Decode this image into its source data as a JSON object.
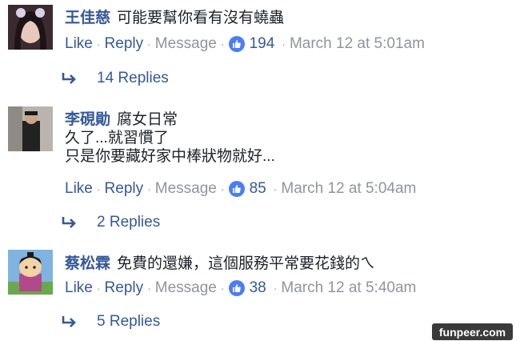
{
  "comments": [
    {
      "author": "王佳慈",
      "lines": [
        "可能要幫你看有沒有蟯蟲"
      ],
      "actions": {
        "like": "Like",
        "reply": "Reply",
        "message": "Message",
        "likes_count": "194",
        "timestamp": "March 12 at 5:01am"
      },
      "replies": "14 Replies"
    },
    {
      "author": "李硯勛",
      "lines": [
        "腐女日常",
        "久了...就習慣了",
        "只是你要藏好家中棒狀物就好..."
      ],
      "actions": {
        "like": "Like",
        "reply": "Reply",
        "message": "Message",
        "likes_count": "85",
        "timestamp": "March 12 at 5:04am"
      },
      "replies": "2 Replies"
    },
    {
      "author": "蔡松霖",
      "lines": [
        "免費的還嫌，這個服務平常要花錢的ㄟ"
      ],
      "actions": {
        "like": "Like",
        "reply": "Reply",
        "message": "Message",
        "likes_count": "38",
        "timestamp": "March 12 at 5:40am"
      },
      "replies": "5 Replies"
    }
  ],
  "watermark": "funpeer.com",
  "colors": {
    "link": "#365899",
    "muted": "#90949c",
    "like_badge": "#4c7ef3",
    "text": "#1d2129"
  }
}
